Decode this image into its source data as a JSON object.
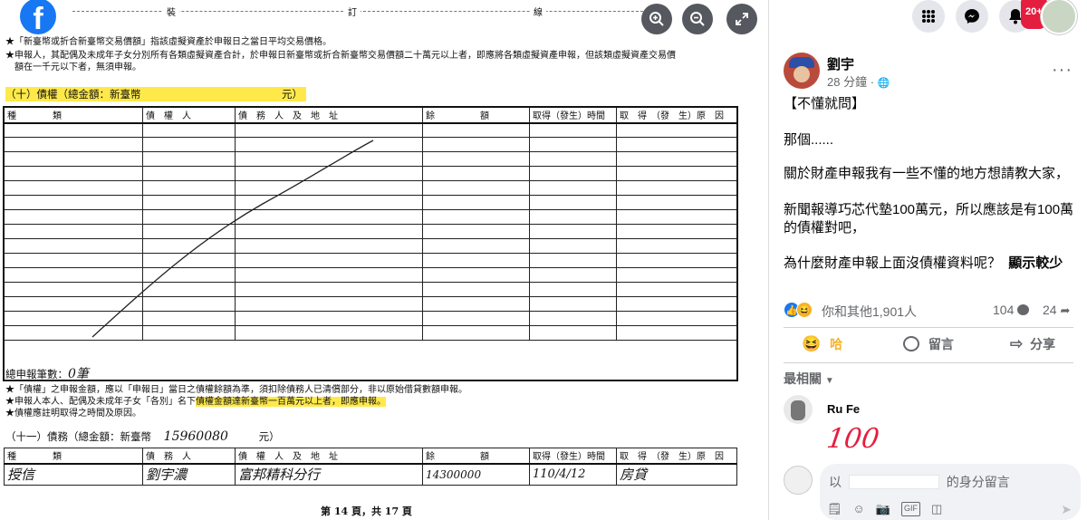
{
  "viewer": {
    "logo_letter": "f",
    "cut_labels": [
      "裝",
      "訂",
      "線"
    ],
    "controls": [
      "zoom-in-icon",
      "zoom-out-icon",
      "fullscreen-icon"
    ]
  },
  "document": {
    "note1": "★「新臺幣或折合新臺幣交易價額」指該虛擬資產於申報日之當日平均交易價格。",
    "note2": "★申報人，其配偶及未成年子女分別所有各類虛擬資產合計，於申報日新臺幣或折合新臺幣交易價額二十萬元以上者，即應將各類虛擬資產申報，但該類虛擬資產交易價",
    "note3": "額在一千元以下者，無須申報。",
    "sec10_title": "（十）債權（總金額：新臺幣",
    "sec10_unit": "元）",
    "creditor_headers": [
      "種　　　　類",
      "債　權　人",
      "債　務　人　及　地　址",
      "餘　　　　　額",
      "取得（發生）時間",
      "取　得　（發　生）原　因"
    ],
    "total_count_label": "總申報筆數：",
    "total_count_value": "0筆",
    "note4": "★「債權」之申報金額，應以「申報日」當日之債權餘額為準，須扣除債務人已清償部分，非以原始借貸數額申報。",
    "note5_a": "★申報人本人、配偶及未成年子女「各別」名下",
    "note5_b": "債權金額達新臺幣一百萬元以上者，即應申報。",
    "note6": "★債權應註明取得之時間及原因。",
    "sec11_title": "（十一）債務（總金額：新臺幣",
    "sec11_amount": "15960080",
    "sec11_unit": "元）",
    "debt_headers": [
      "種　　　　類",
      "債　務　人",
      "債　權　人　及　地　址",
      "餘　　　　　額",
      "取得（發生）時間",
      "取　得　（發　生）原　因"
    ],
    "debt_row": [
      "授信",
      "劉宇濃",
      "富邦精科分行",
      "14300000",
      "110/4/12",
      "房貸"
    ],
    "page_label": "第 14 頁，共 17 頁"
  },
  "topbar": {
    "icons": [
      "apps-grid-icon",
      "messenger-icon",
      "notifications-icon"
    ],
    "notification_count": "20+"
  },
  "post": {
    "author": "劉宇",
    "time": "28 分鐘",
    "line1": "【不懂就問】",
    "line2": "那個......",
    "line3": "關於財產申報我有一些不懂的地方想請教大家，",
    "line4a": "新聞報導巧芯代墊100萬元，所以應該是有100萬",
    "line4b": "的債權對吧，",
    "line5": "為什麼財產申報上面沒債權資料呢？",
    "see_more": "顯示較少",
    "reactions_text": "你和其他1,901人",
    "comments_count": "104",
    "shares_count": "24",
    "actions": [
      "哈",
      "留言",
      "分享"
    ],
    "sort_label": "最相關",
    "comment_author": "Ru Fe",
    "comment_text": "100",
    "composer_prefix": "以",
    "composer_suffix": "的身分留言",
    "composer_icons": [
      "sticker-icon",
      "emoji-icon",
      "camera-icon",
      "gif-icon",
      "stickers-icon"
    ],
    "colors": {
      "link": "#1877f2",
      "haha": "#f7b125",
      "red": "#e41e3f"
    }
  }
}
